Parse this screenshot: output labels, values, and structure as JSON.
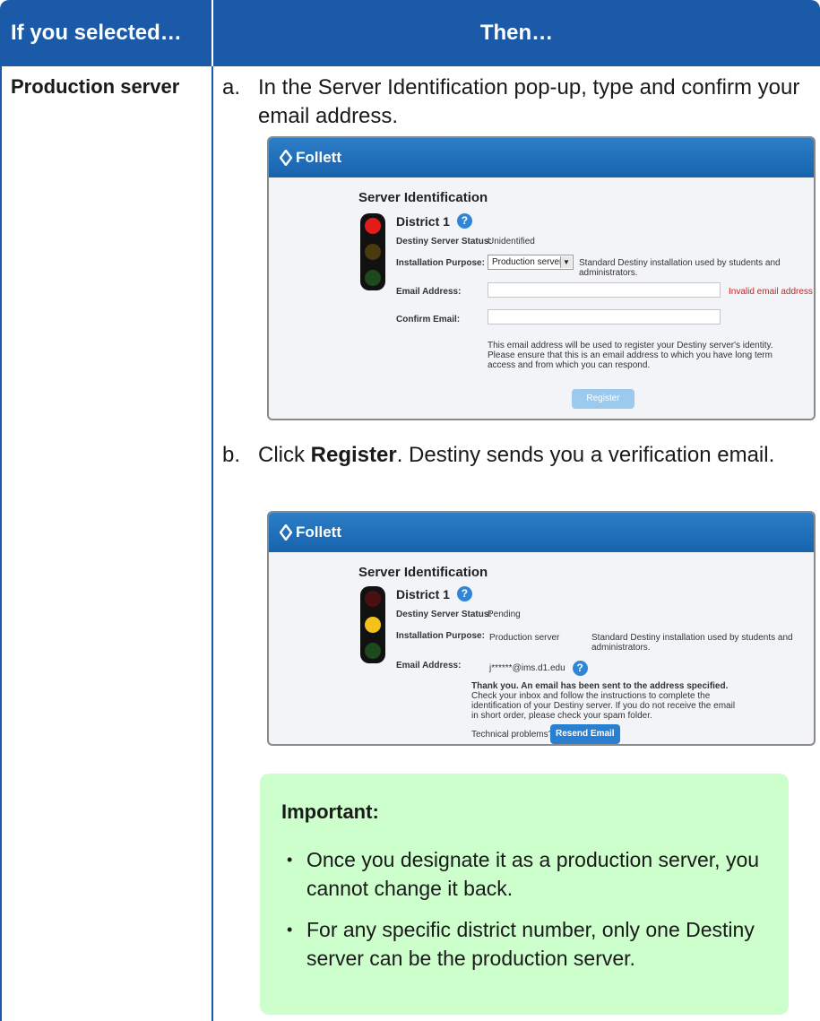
{
  "table": {
    "col1_header": "If you selected…",
    "col2_header": "Then…",
    "row_label": "Production server"
  },
  "step_a": {
    "marker": "a.",
    "text": "In the Server Identification pop-up, type and confirm your email address."
  },
  "step_b": {
    "marker": "b.",
    "text_pre": "Click ",
    "text_bold": "Register",
    "text_post": ". Destiny sends you a verification email."
  },
  "shot1": {
    "brand": "Follett",
    "title": "Server Identification",
    "district": "District 1",
    "status_label": "Destiny Server Status:",
    "status_value": "Unidentified",
    "purpose_label": "Installation Purpose:",
    "purpose_value": "Production server",
    "purpose_desc": "Standard Destiny installation used by students and administrators.",
    "email_label": "Email Address:",
    "email_value": "",
    "email_error": "Invalid email address",
    "confirm_label": "Confirm Email:",
    "confirm_value": "",
    "note": "This email address will be used to register your Destiny server's identity. Please ensure that this is an email address to which you have long term access and from which you can respond.",
    "register_button": "Register",
    "light_state": "red"
  },
  "shot2": {
    "brand": "Follett",
    "title": "Server Identification",
    "district": "District 1",
    "status_label": "Destiny Server Status:",
    "status_value": "Pending",
    "purpose_label": "Installation Purpose:",
    "purpose_value": "Production server",
    "purpose_desc": "Standard Destiny installation used by students and administrators.",
    "email_label": "Email Address:",
    "email_value": "j******@ims.d1.edu",
    "thanks_bold": "Thank you. An email has been sent to the address specified.",
    "thanks_body": "Check your inbox and follow the instructions to complete the identification of your Destiny server. If you do not receive the email in short order, please check your spam folder.",
    "tech_problems": "Technical problems?",
    "resend_button": "Resend Email",
    "light_state": "yellow"
  },
  "important": {
    "title": "Important:",
    "items": [
      "Once you designate it as a production server, you cannot change it back.",
      "For any specific district number, only one Destiny server can be the production server."
    ]
  },
  "colors": {
    "header_blue": "#1a5aa8",
    "important_bg": "#ccffcc"
  }
}
